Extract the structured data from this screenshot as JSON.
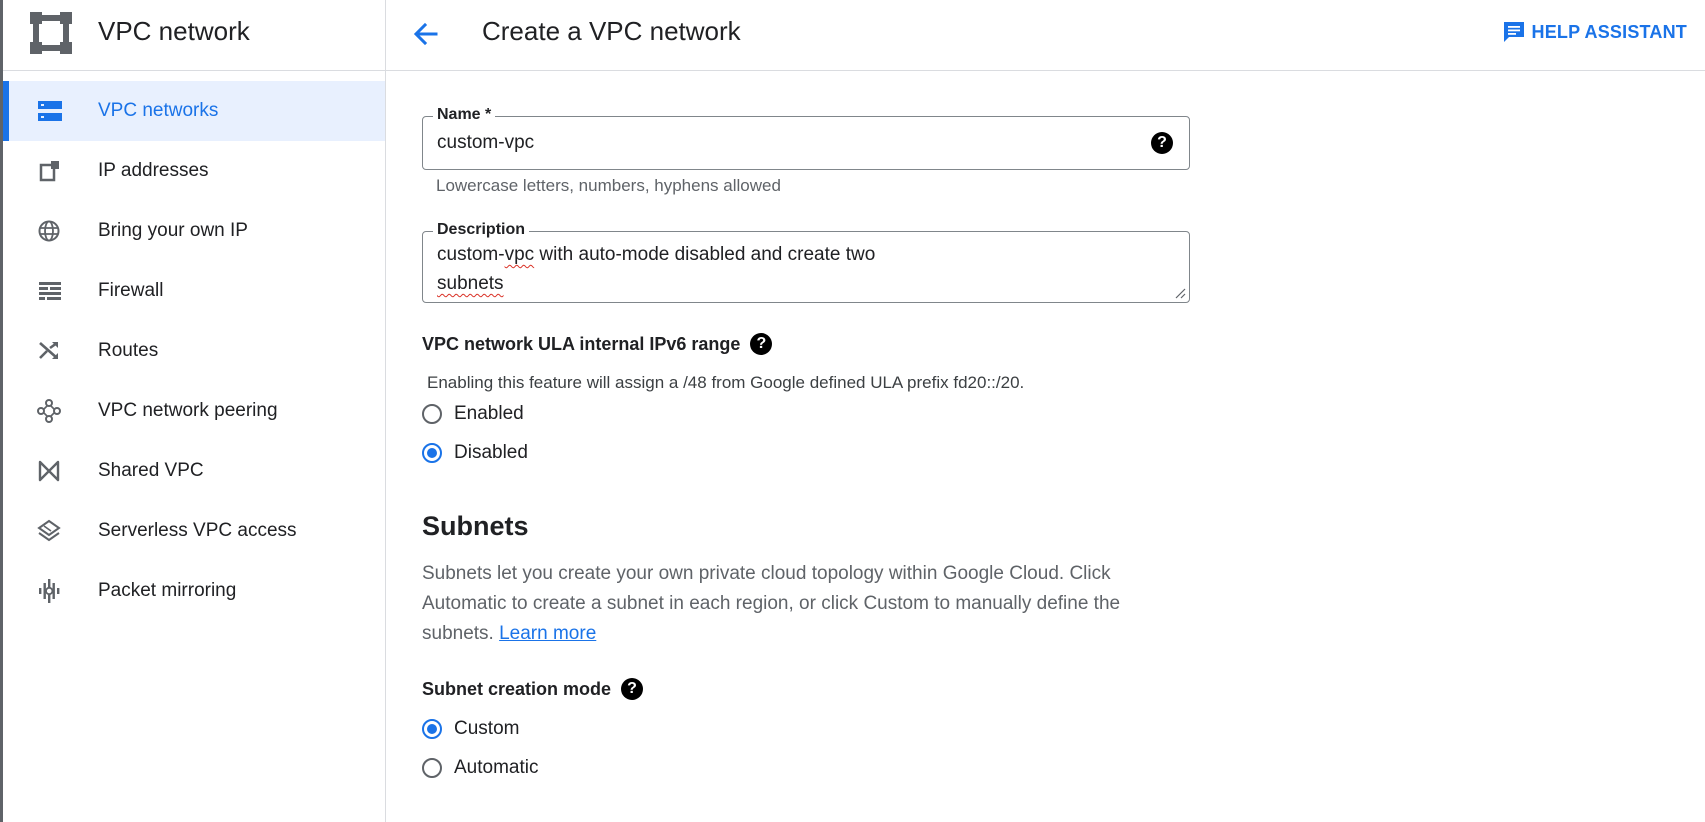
{
  "sidebar": {
    "product_title": "VPC network",
    "items": [
      {
        "label": "VPC networks",
        "icon": "vpc-networks-icon",
        "active": true
      },
      {
        "label": "IP addresses",
        "icon": "ip-addresses-icon"
      },
      {
        "label": "Bring your own IP",
        "icon": "globe-icon"
      },
      {
        "label": "Firewall",
        "icon": "firewall-icon"
      },
      {
        "label": "Routes",
        "icon": "routes-icon"
      },
      {
        "label": "VPC network peering",
        "icon": "peering-icon"
      },
      {
        "label": "Shared VPC",
        "icon": "shared-vpc-icon"
      },
      {
        "label": "Serverless VPC access",
        "icon": "serverless-icon"
      },
      {
        "label": "Packet mirroring",
        "icon": "packet-mirroring-icon"
      }
    ]
  },
  "header": {
    "title": "Create a VPC network",
    "help_label": "HELP ASSISTANT"
  },
  "form": {
    "name": {
      "label": "Name *",
      "value": "custom-vpc",
      "hint": "Lowercase letters, numbers, hyphens allowed"
    },
    "description": {
      "label": "Description",
      "line1_prefix": "custom-",
      "line1_misspelled": "vpc",
      "line1_suffix": " with auto-mode disabled and create two",
      "line2": "subnets"
    },
    "ula": {
      "label": "VPC network ULA internal IPv6 range",
      "description": "Enabling this feature will assign a /48 from Google defined ULA prefix fd20::/20.",
      "options": [
        "Enabled",
        "Disabled"
      ],
      "selected": "Disabled"
    },
    "subnets": {
      "heading": "Subnets",
      "description": "Subnets let you create your own private cloud topology within Google Cloud. Click Automatic to create a subnet in each region, or click Custom to manually define the subnets. ",
      "learn_more": "Learn more",
      "mode_label": "Subnet creation mode",
      "mode_options": [
        "Custom",
        "Automatic"
      ],
      "mode_selected": "Custom"
    }
  },
  "colors": {
    "accent": "#1a73e8",
    "active_bg": "#e8f0fe",
    "text": "#202124",
    "muted": "#5f6368",
    "spellcheck": "#d93025"
  }
}
